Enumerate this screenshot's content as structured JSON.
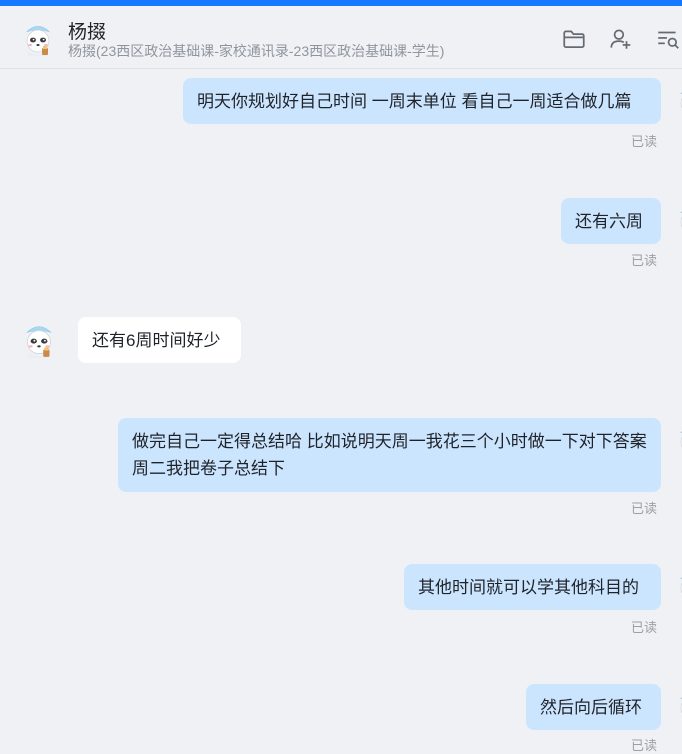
{
  "header": {
    "name": "杨掇",
    "subtitle": "杨掇(23西区政治基础课-家校通讯录-23西区政治基础课-学生)"
  },
  "icons": {
    "folder": "folder-icon",
    "add_member": "add-person-icon",
    "search_history": "search-list-icon"
  },
  "messages": [
    {
      "direction": "out",
      "text": "明天你规划好自己时间 一周末单位 看自己一周适合做几篇",
      "status": "已读"
    },
    {
      "direction": "out",
      "text": "还有六周",
      "status": "已读"
    },
    {
      "direction": "in",
      "text": "还有6周时间好少"
    },
    {
      "direction": "out",
      "text": "做完自己一定得总结哈 比如说明天周一我花三个小时做一下对下答案   周二我把卷子总结下",
      "status": "已读"
    },
    {
      "direction": "out",
      "text": "其他时间就可以学其他科目的",
      "status": "已读"
    },
    {
      "direction": "out",
      "text": "然后向后循环",
      "status": "已读"
    }
  ],
  "colors": {
    "accent": "#1677ff",
    "outgoing_bubble": "#cce5ff",
    "incoming_bubble": "#ffffff",
    "background": "#f0f1f4"
  }
}
